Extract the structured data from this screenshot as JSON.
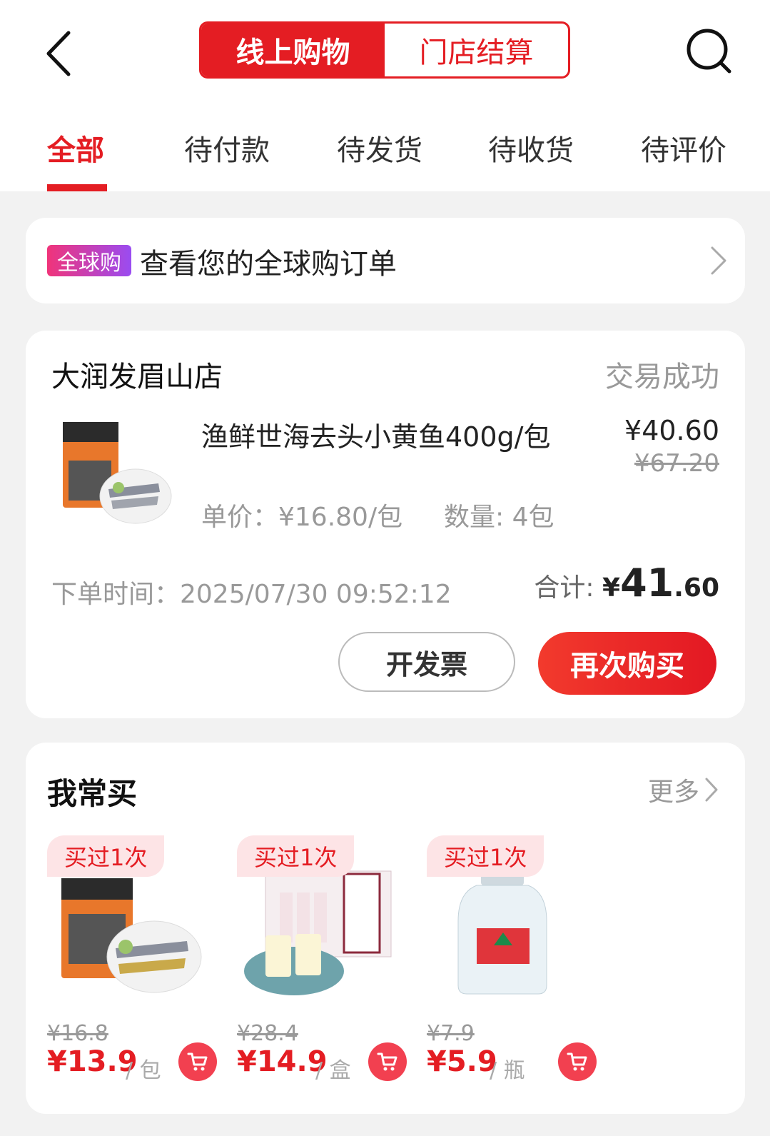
{
  "header": {
    "segments": [
      "线上购物",
      "门店结算"
    ],
    "tabs": [
      "全部",
      "待付款",
      "待发货",
      "待收货",
      "待评价"
    ]
  },
  "global": {
    "badge": "全球购",
    "text": "查看您的全球购订单"
  },
  "order": {
    "store": "大润发眉山店",
    "status": "交易成功",
    "product_name": "渔鲜世海去头小黄鱼400g/包",
    "price": "¥40.60",
    "old_price": "¥67.20",
    "unit_price": "单价：¥16.80/包",
    "quantity": "数量: 4包",
    "order_time": "下单时间：2025/07/30 09:52:12",
    "total_label": "合计: ",
    "total_currency": "¥",
    "total_int": "41",
    "total_dec": ".60",
    "invoice_btn": "开发票",
    "rebuy_btn": "再次购买"
  },
  "frequent": {
    "title": "我常买",
    "more": "更多",
    "items": [
      {
        "badge": "买过1次",
        "old": "¥16.8",
        "price": "¥13.9",
        "unit": "/ 包"
      },
      {
        "badge": "买过1次",
        "old": "¥28.4",
        "price": "¥14.9",
        "unit": "/ 盒"
      },
      {
        "badge": "买过1次",
        "old": "¥7.9",
        "price": "¥5.9",
        "unit": "/ 瓶"
      }
    ]
  },
  "colors": {
    "accent": "#e41d23",
    "badge_gradient_start": "#f0347a",
    "badge_gradient_end": "#9a4cf1"
  }
}
